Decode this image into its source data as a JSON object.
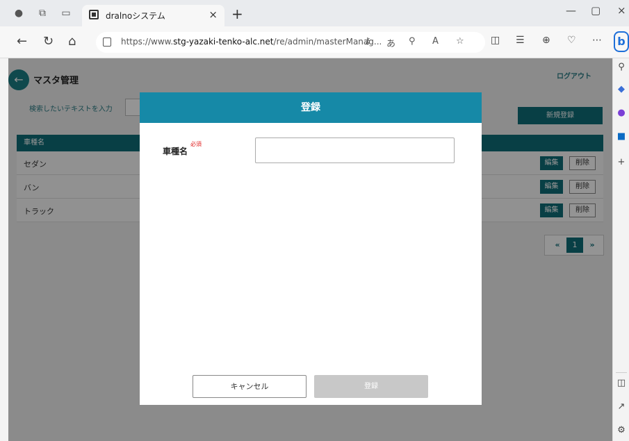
{
  "browser": {
    "tab_title": "dralnoシステム",
    "tab_close": "×",
    "new_tab": "+",
    "url_prefix": "https://www.",
    "url_domain": "stg-yazaki-tenko-alc.net",
    "url_path": "/re/admin/masterManag...",
    "window_controls": {
      "minimize": "—",
      "maximize": "▢",
      "close": "×"
    }
  },
  "page": {
    "title": "マスタ管理",
    "logout": "ログアウト",
    "search_label": "検索したいテキストを入力",
    "new_button": "新規登録",
    "table": {
      "header": "車種名",
      "rows": [
        {
          "name": "セダン",
          "edit": "編集",
          "delete": "削除"
        },
        {
          "name": "バン",
          "edit": "編集",
          "delete": "削除"
        },
        {
          "name": "トラック",
          "edit": "編集",
          "delete": "削除"
        }
      ]
    },
    "pagination": {
      "prev": "«",
      "current": "1",
      "next": "»"
    }
  },
  "modal": {
    "title": "登録",
    "field_label": "車種名",
    "required": "必須",
    "field_value": "",
    "cancel": "キャンセル",
    "submit": "登録"
  },
  "colors": {
    "teal": "#0f6d78",
    "modal_header": "#1689a7",
    "required": "#e02020",
    "disabled": "#c8c8c8"
  }
}
